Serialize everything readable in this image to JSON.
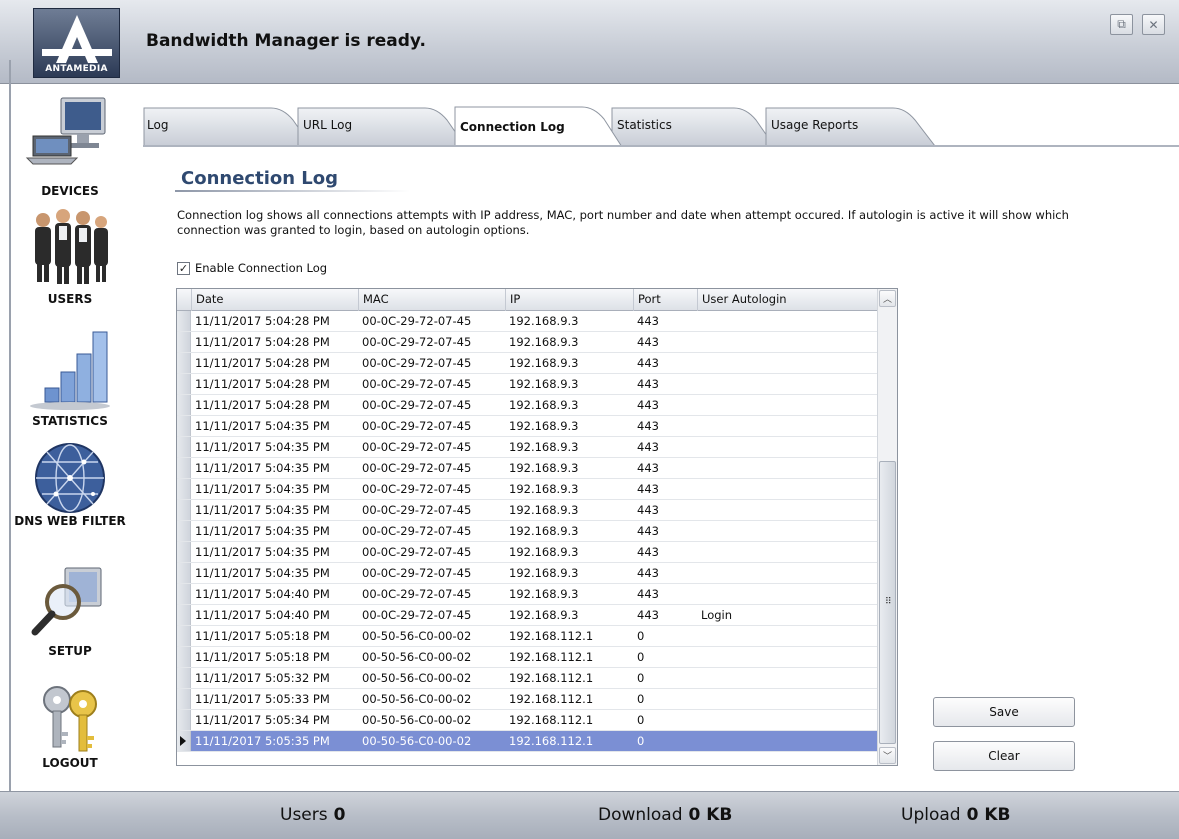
{
  "app": {
    "status_title": "Bandwidth Manager is ready.",
    "logo_text": "ANTAMEDIA",
    "window_buttons": [
      "restore-icon",
      "close-icon"
    ]
  },
  "sidebar": {
    "items": [
      {
        "label": "DEVICES",
        "icon": "computer-icon"
      },
      {
        "label": "USERS",
        "icon": "people-icon"
      },
      {
        "label": "STATISTICS",
        "icon": "bar-chart-icon"
      },
      {
        "label": "DNS WEB FILTER",
        "icon": "globe-icon"
      },
      {
        "label": "SETUP",
        "icon": "magnifier-monitor-icon"
      },
      {
        "label": "LOGOUT",
        "icon": "keys-icon"
      }
    ]
  },
  "tabs": [
    {
      "label": "Log",
      "active": false
    },
    {
      "label": "URL Log",
      "active": false
    },
    {
      "label": "Connection Log",
      "active": true
    },
    {
      "label": "Statistics",
      "active": false
    },
    {
      "label": "Usage Reports",
      "active": false
    }
  ],
  "content": {
    "title": "Connection Log",
    "description": "Connection log shows all connections attempts with IP address, MAC, port number and date when attempt occured. If autologin is active it will show which connection was granted to login, based on autologin options.",
    "enable_checkbox": {
      "label": "Enable Connection Log",
      "checked": true
    }
  },
  "grid": {
    "columns": [
      "Date",
      "MAC",
      "IP",
      "Port",
      "User Autologin"
    ],
    "rows": [
      [
        "11/11/2017 5:04:28 PM",
        "00-0C-29-72-07-45",
        "192.168.9.3",
        "443",
        ""
      ],
      [
        "11/11/2017 5:04:28 PM",
        "00-0C-29-72-07-45",
        "192.168.9.3",
        "443",
        ""
      ],
      [
        "11/11/2017 5:04:28 PM",
        "00-0C-29-72-07-45",
        "192.168.9.3",
        "443",
        ""
      ],
      [
        "11/11/2017 5:04:28 PM",
        "00-0C-29-72-07-45",
        "192.168.9.3",
        "443",
        ""
      ],
      [
        "11/11/2017 5:04:28 PM",
        "00-0C-29-72-07-45",
        "192.168.9.3",
        "443",
        ""
      ],
      [
        "11/11/2017 5:04:35 PM",
        "00-0C-29-72-07-45",
        "192.168.9.3",
        "443",
        ""
      ],
      [
        "11/11/2017 5:04:35 PM",
        "00-0C-29-72-07-45",
        "192.168.9.3",
        "443",
        ""
      ],
      [
        "11/11/2017 5:04:35 PM",
        "00-0C-29-72-07-45",
        "192.168.9.3",
        "443",
        ""
      ],
      [
        "11/11/2017 5:04:35 PM",
        "00-0C-29-72-07-45",
        "192.168.9.3",
        "443",
        ""
      ],
      [
        "11/11/2017 5:04:35 PM",
        "00-0C-29-72-07-45",
        "192.168.9.3",
        "443",
        ""
      ],
      [
        "11/11/2017 5:04:35 PM",
        "00-0C-29-72-07-45",
        "192.168.9.3",
        "443",
        ""
      ],
      [
        "11/11/2017 5:04:35 PM",
        "00-0C-29-72-07-45",
        "192.168.9.3",
        "443",
        ""
      ],
      [
        "11/11/2017 5:04:35 PM",
        "00-0C-29-72-07-45",
        "192.168.9.3",
        "443",
        ""
      ],
      [
        "11/11/2017 5:04:40 PM",
        "00-0C-29-72-07-45",
        "192.168.9.3",
        "443",
        ""
      ],
      [
        "11/11/2017 5:04:40 PM",
        "00-0C-29-72-07-45",
        "192.168.9.3",
        "443",
        "Login"
      ],
      [
        "11/11/2017 5:05:18 PM",
        "00-50-56-C0-00-02",
        "192.168.112.1",
        "0",
        ""
      ],
      [
        "11/11/2017 5:05:18 PM",
        "00-50-56-C0-00-02",
        "192.168.112.1",
        "0",
        ""
      ],
      [
        "11/11/2017 5:05:32 PM",
        "00-50-56-C0-00-02",
        "192.168.112.1",
        "0",
        ""
      ],
      [
        "11/11/2017 5:05:33 PM",
        "00-50-56-C0-00-02",
        "192.168.112.1",
        "0",
        ""
      ],
      [
        "11/11/2017 5:05:34 PM",
        "00-50-56-C0-00-02",
        "192.168.112.1",
        "0",
        ""
      ],
      [
        "11/11/2017 5:05:35 PM",
        "00-50-56-C0-00-02",
        "192.168.112.1",
        "0",
        ""
      ]
    ],
    "selected_row": 20
  },
  "buttons": {
    "save": "Save",
    "clear": "Clear"
  },
  "statusbar": {
    "users_label": "Users",
    "users_value": "0",
    "download_label": "Download",
    "download_value": "0 KB",
    "upload_label": "Upload",
    "upload_value": "0 KB"
  },
  "colors": {
    "selected_row": "#7b8fd4",
    "title_blue": "#2f4970"
  }
}
